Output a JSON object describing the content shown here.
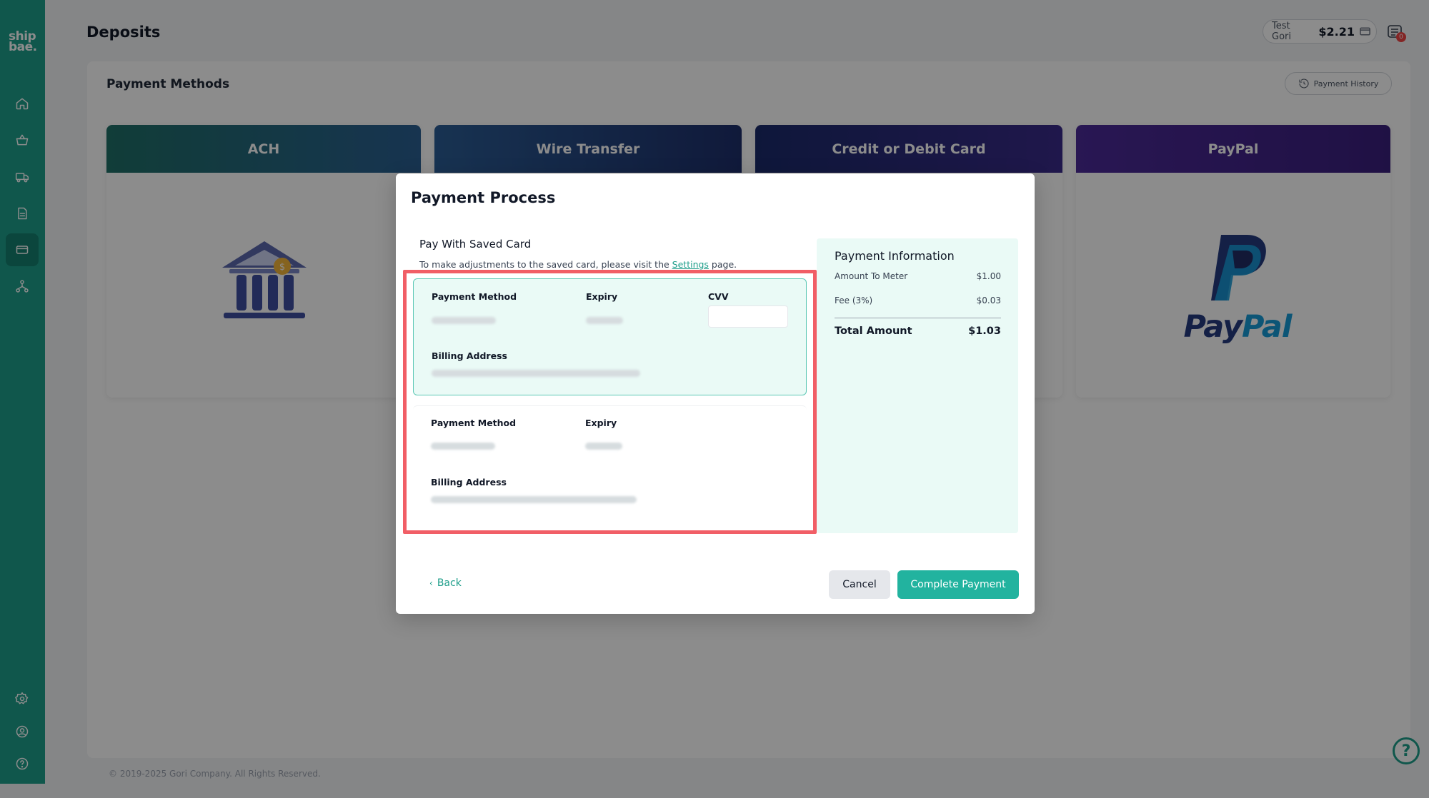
{
  "app": {
    "logo_text": "ship bae."
  },
  "header": {
    "title": "Deposits",
    "user_name": "Test Gori",
    "balance": "$2.21",
    "notification_count": "0"
  },
  "panel": {
    "title": "Payment Methods",
    "history_label": "Payment History",
    "methods": [
      {
        "label": "ACH",
        "color_from": "#1f6f67",
        "color_to": "#2a5f92"
      },
      {
        "label": "Wire Transfer",
        "color_from": "#2b5d95",
        "color_to": "#1e2f6b"
      },
      {
        "label": "Credit or Debit Card",
        "color_from": "#1b2a6b",
        "color_to": "#3a2b8a"
      },
      {
        "label": "PayPal",
        "color_from": "#4b2a98",
        "color_to": "#3a1f7d"
      }
    ],
    "paypal_logo": {
      "pay": "Pay",
      "pal": "Pal"
    }
  },
  "footer": {
    "copyright": "© 2019-2025 Gori Company. All Rights Reserved."
  },
  "modal": {
    "title": "Payment Process",
    "saved_title": "Pay With Saved Card",
    "note_prefix": "To make adjustments to the saved card, please visit the ",
    "note_link": "Settings",
    "note_suffix": " page.",
    "cards": [
      {
        "method_label": "Payment Method",
        "expiry_label": "Expiry",
        "cvv_label": "CVV",
        "billing_label": "Billing Address"
      },
      {
        "method_label": "Payment Method",
        "expiry_label": "Expiry",
        "billing_label": "Billing Address"
      }
    ],
    "payment_info": {
      "title": "Payment Information",
      "amount_label": "Amount To Meter",
      "amount_value": "$1.00",
      "fee_label": "Fee (3%)",
      "fee_value": "$0.03",
      "total_label": "Total Amount",
      "total_value": "$1.03"
    },
    "back_label": "Back",
    "cancel_label": "Cancel",
    "complete_label": "Complete Payment"
  },
  "colors": {
    "brand": "#1e9e8a",
    "highlight": "#f15e66",
    "info_bg": "#eafaf6"
  }
}
